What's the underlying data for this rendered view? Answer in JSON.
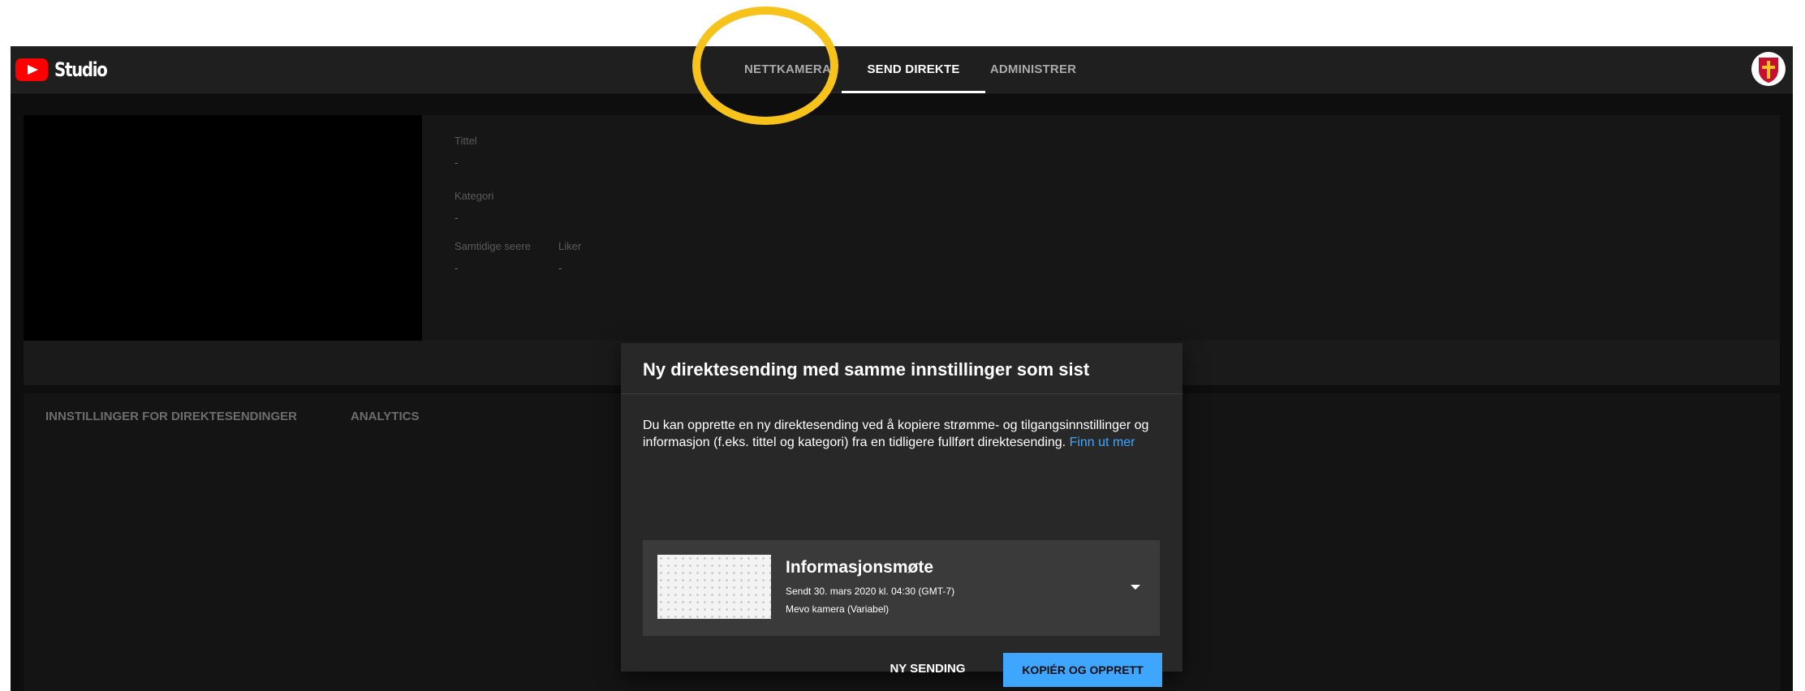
{
  "app": {
    "name": "Studio",
    "tabs": [
      {
        "label": "NETTKAMERA",
        "active": false
      },
      {
        "label": "SEND DIREKTE",
        "active": true
      },
      {
        "label": "ADMINISTRER",
        "active": false
      }
    ]
  },
  "info": {
    "title_label": "Tittel",
    "title_value": "-",
    "category_label": "Kategori",
    "category_value": "-",
    "concurrent_label": "Samtidige seere",
    "concurrent_value": "-",
    "likes_label": "Liker",
    "likes_value": "-"
  },
  "lower_tabs": {
    "settings": "INNSTILLINGER FOR DIREKTESENDINGER",
    "analytics": "ANALYTICS"
  },
  "dialog": {
    "title": "Ny direktesending med samme innstillinger som sist",
    "body_text": "Du kan opprette en ny direktesending ved å kopiere strømme- og tilgangsinnstillinger og informasjon (f.eks. tittel og kategori) fra en tidligere fullført direktesending.",
    "link": "Finn ut mer",
    "stream": {
      "title": "Informasjonsmøte",
      "sent": "Sendt 30. mars 2020 kl. 04:30 (GMT-7)",
      "camera": "Mevo kamera (Variabel)"
    },
    "new_button": "NY SENDING",
    "copy_button": "KOPIÉR OG OPPRETT"
  },
  "colors": {
    "accent": "#3ea6ff",
    "highlight": "#f7c21a",
    "brand_red": "#ff0000"
  }
}
